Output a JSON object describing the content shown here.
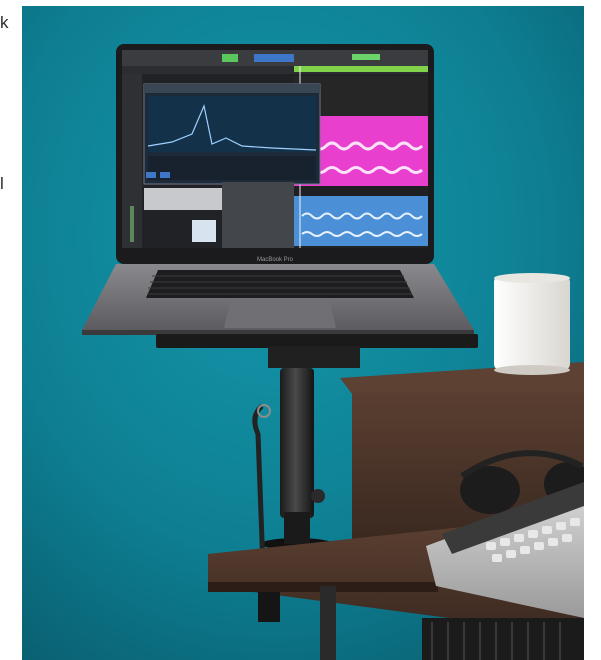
{
  "edge_fragments": [
    "k",
    "l"
  ],
  "laptop_label": "MacBook Pro",
  "colors": {
    "wall": "#0e7f93",
    "desk": "#4a3327",
    "mug": "#f4f2ee",
    "track_pink": "#e83fcf",
    "track_blue": "#4b8fd6",
    "track_green": "#7fd24a"
  }
}
